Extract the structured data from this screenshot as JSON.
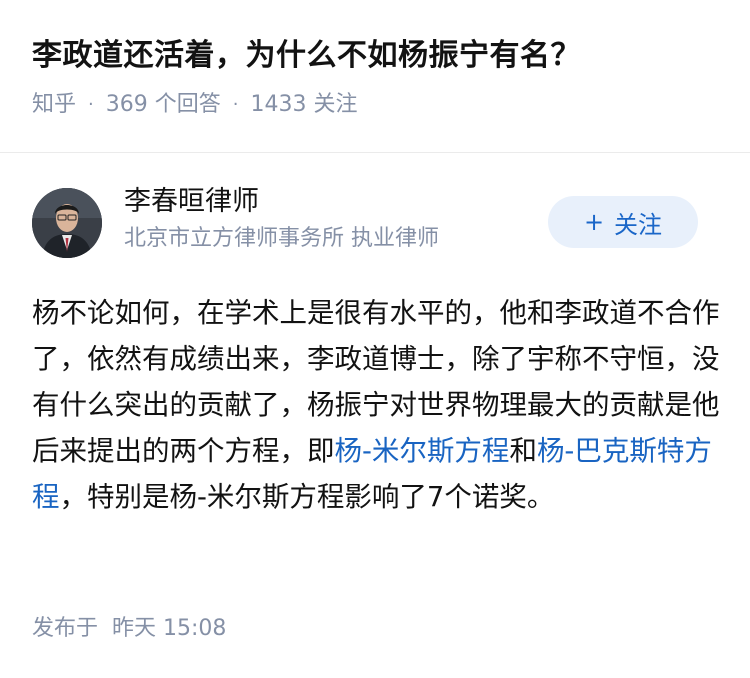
{
  "question": {
    "title": "李政道还活着，为什么不如杨振宁有名？",
    "source": "知乎",
    "separator": "·",
    "answer_count": "369 个回答",
    "follower_count": "1433 关注"
  },
  "author": {
    "name": "李春晅律师",
    "description": "北京市立方律师事务所 执业律师",
    "follow_icon": "+",
    "follow_label": "关注"
  },
  "answer": {
    "segments": [
      {
        "text": "杨不论如何，在学术上是很有水平的，他和李政道不合作了，依然有成绩出来，李政道博士，除了宇称不守恒，没有什么突出的贡献了，杨振宁对世界物理最大的贡献是他后来提出的两个方程，即",
        "link": false
      },
      {
        "text": "杨-米尔斯方程",
        "link": true
      },
      {
        "text": "和",
        "link": false
      },
      {
        "text": "杨-巴克斯特方程",
        "link": true
      },
      {
        "text": "，特别是杨-米尔斯方程影响了7个诺奖。",
        "link": false
      }
    ]
  },
  "publish": {
    "label": "发布于",
    "time": "昨天 15:08"
  },
  "colors": {
    "link": "#1964c2",
    "meta": "#8590a6",
    "follow_bg": "#e8f0fb",
    "follow_text": "#1a66c8"
  }
}
